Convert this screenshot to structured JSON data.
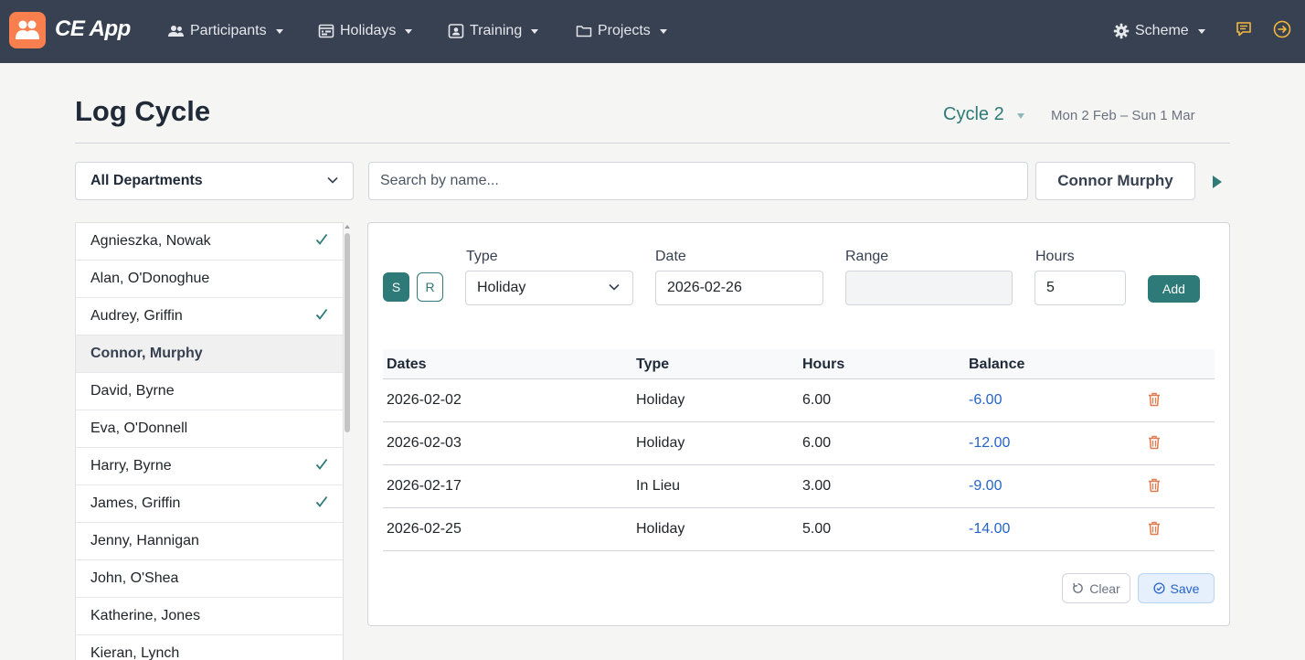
{
  "app": {
    "brand": "CE App"
  },
  "nav": {
    "items": [
      {
        "label": "Participants",
        "icon": "users-icon"
      },
      {
        "label": "Holidays",
        "icon": "calendar-icon"
      },
      {
        "label": "Training",
        "icon": "id-card-icon"
      },
      {
        "label": "Projects",
        "icon": "folder-icon"
      }
    ],
    "scheme_label": "Scheme"
  },
  "header": {
    "title": "Log Cycle",
    "cycle": "Cycle 2",
    "cycle_range": "Mon 2 Feb – Sun 1 Mar"
  },
  "filters": {
    "department": "All Departments",
    "search_placeholder": "Search by name...",
    "selected_person": "Connor Murphy"
  },
  "participants": [
    {
      "name": "Agnieszka, Nowak",
      "checked": true
    },
    {
      "name": "Alan, O'Donoghue",
      "checked": false
    },
    {
      "name": "Audrey, Griffin",
      "checked": true
    },
    {
      "name": "Connor, Murphy",
      "checked": false,
      "active": true
    },
    {
      "name": "David, Byrne",
      "checked": false
    },
    {
      "name": "Eva, O'Donnell",
      "checked": false
    },
    {
      "name": "Harry, Byrne",
      "checked": true
    },
    {
      "name": "James, Griffin",
      "checked": true
    },
    {
      "name": "Jenny, Hannigan",
      "checked": false
    },
    {
      "name": "John, O'Shea",
      "checked": false
    },
    {
      "name": "Katherine, Jones",
      "checked": false
    },
    {
      "name": "Kieran, Lynch",
      "checked": false
    }
  ],
  "form": {
    "mode_s": "S",
    "mode_r": "R",
    "type_label": "Type",
    "type_value": "Holiday",
    "date_label": "Date",
    "date_value": "2026-02-26",
    "range_label": "Range",
    "range_value": "",
    "hours_label": "Hours",
    "hours_value": "5",
    "add_label": "Add"
  },
  "table": {
    "headers": [
      "Dates",
      "Type",
      "Hours",
      "Balance"
    ],
    "rows": [
      {
        "date": "2026-02-02",
        "type": "Holiday",
        "hours": "6.00",
        "balance": "-6.00"
      },
      {
        "date": "2026-02-03",
        "type": "Holiday",
        "hours": "6.00",
        "balance": "-12.00"
      },
      {
        "date": "2026-02-17",
        "type": "In Lieu",
        "hours": "3.00",
        "balance": "-9.00"
      },
      {
        "date": "2026-02-25",
        "type": "Holiday",
        "hours": "5.00",
        "balance": "-14.00"
      }
    ]
  },
  "actions": {
    "clear_label": "Clear",
    "save_label": "Save"
  },
  "colors": {
    "navbar": "#374151",
    "accent": "#2d7a78",
    "logo": "#f97f4f",
    "balance": "#2563c9",
    "delete": "#e07a4f"
  }
}
